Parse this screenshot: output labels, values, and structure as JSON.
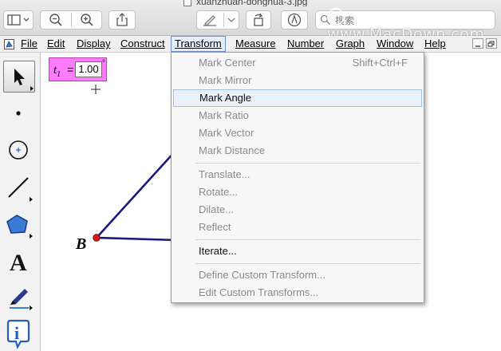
{
  "window": {
    "file_title": "xuanzhuan-donghua-3.jpg",
    "search_placeholder": "搜索",
    "watermark": "www.MacDown.com"
  },
  "menubar": {
    "items": [
      {
        "label": "File",
        "active": false
      },
      {
        "label": "Edit",
        "active": false
      },
      {
        "label": "Display",
        "active": false
      },
      {
        "label": "Construct",
        "active": false
      },
      {
        "label": "Transform",
        "active": true
      },
      {
        "label": "Measure",
        "active": false
      },
      {
        "label": "Number",
        "active": false
      },
      {
        "label": "Graph",
        "active": false
      },
      {
        "label": "Window",
        "active": false
      },
      {
        "label": "Help",
        "active": false
      }
    ]
  },
  "toolbox": {
    "tools": [
      "arrow-select-icon",
      "point-icon",
      "compass-circle-icon",
      "straightedge-icon",
      "polygon-icon",
      "text-tool-icon",
      "marker-icon",
      "information-icon"
    ],
    "text_tool_label": "A",
    "info_label": "i"
  },
  "canvas": {
    "parameter": {
      "name": "t",
      "subscript": "1",
      "equals": "=",
      "value": "1.00",
      "unit": "°"
    },
    "point_label": "B",
    "line_color": "#1a1a7a",
    "point_color": "#e0141e"
  },
  "transform_menu": {
    "items": [
      {
        "label": "Mark Center",
        "shortcut": "Shift+Ctrl+F",
        "enabled": false
      },
      {
        "label": "Mark Mirror",
        "shortcut": "",
        "enabled": false
      },
      {
        "label": "Mark Angle",
        "shortcut": "",
        "enabled": true
      },
      {
        "label": "Mark Ratio",
        "shortcut": "",
        "enabled": false
      },
      {
        "label": "Mark Vector",
        "shortcut": "",
        "enabled": false
      },
      {
        "label": "Mark Distance",
        "shortcut": "",
        "enabled": false
      },
      {
        "label": "Translate...",
        "shortcut": "",
        "enabled": false
      },
      {
        "label": "Rotate...",
        "shortcut": "",
        "enabled": false
      },
      {
        "label": "Dilate...",
        "shortcut": "",
        "enabled": false
      },
      {
        "label": "Reflect",
        "shortcut": "",
        "enabled": false
      },
      {
        "label": "Iterate...",
        "shortcut": "",
        "enabled": true
      },
      {
        "label": "Define Custom Transform...",
        "shortcut": "",
        "enabled": false
      },
      {
        "label": "Edit Custom Transforms...",
        "shortcut": "",
        "enabled": false
      }
    ]
  },
  "colors": {
    "menu_highlight": "#e9f1fb",
    "param_background": "#ff7cff",
    "disabled_text": "#8a8a8a"
  }
}
